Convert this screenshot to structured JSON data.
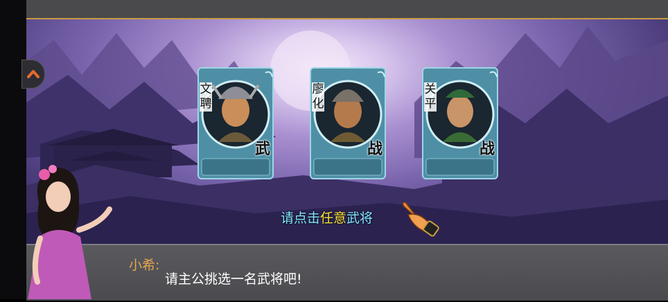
{
  "cards": [
    {
      "name": "文聘",
      "class": "武",
      "armor": "#6b5a3a"
    },
    {
      "name": "廖化",
      "class": "战",
      "armor": "#6e5b33"
    },
    {
      "name": "关平",
      "class": "战",
      "armor": "#3a6b35"
    }
  ],
  "prompt": {
    "part1": "请点击",
    "highlight": "任意",
    "part2": "武将"
  },
  "dialog": {
    "speaker": "小希:",
    "text": "请主公挑选一名武将吧!"
  },
  "colors": {
    "card_frame": "#4f8fa6",
    "prompt": "#86e6ff",
    "highlight": "#ffe23b",
    "speaker": "#e6a64f"
  },
  "icons": [
    "back-arrow-icon",
    "pointing-hand-icon"
  ]
}
